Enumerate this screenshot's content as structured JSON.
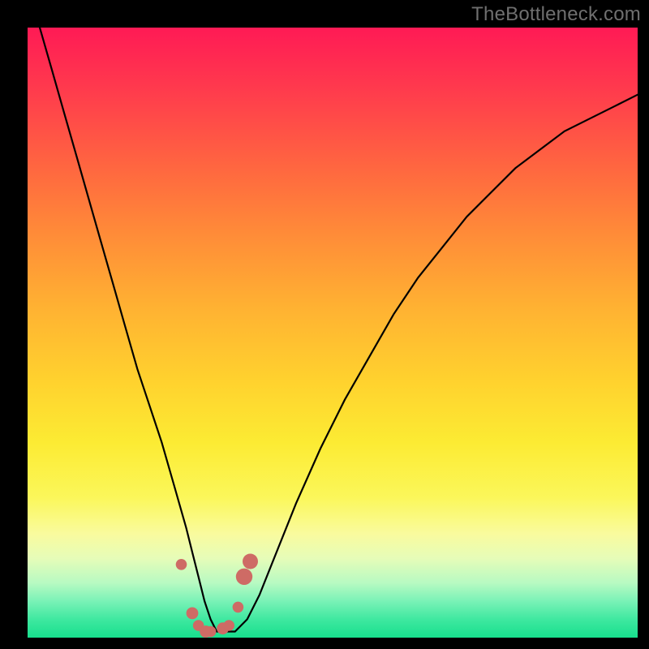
{
  "watermark": "TheBottleneck.com",
  "colors": {
    "frame": "#000000",
    "curve": "#000000",
    "markers": "#ce6b65",
    "gradient_top": "#ff1a55",
    "gradient_bottom": "#17df8d"
  },
  "chart_data": {
    "type": "line",
    "title": "",
    "xlabel": "",
    "ylabel": "",
    "xlim": [
      0,
      100
    ],
    "ylim": [
      0,
      100
    ],
    "series": [
      {
        "name": "bottleneck-curve",
        "x": [
          0,
          1,
          2,
          4,
          6,
          8,
          10,
          12,
          14,
          16,
          18,
          20,
          22,
          24,
          26,
          27,
          28,
          29,
          30,
          31,
          32,
          34,
          36,
          38,
          40,
          44,
          48,
          52,
          56,
          60,
          64,
          68,
          72,
          76,
          80,
          84,
          88,
          92,
          96,
          100
        ],
        "values": [
          108,
          104,
          100,
          93,
          86,
          79,
          72,
          65,
          58,
          51,
          44,
          38,
          32,
          25,
          18,
          14,
          10,
          6,
          3,
          1,
          1,
          1,
          3,
          7,
          12,
          22,
          31,
          39,
          46,
          53,
          59,
          64,
          69,
          73,
          77,
          80,
          83,
          85,
          87,
          89
        ]
      }
    ],
    "markers": [
      {
        "x": 25.2,
        "y": 12.0,
        "r": 1.0
      },
      {
        "x": 27.0,
        "y": 4.0,
        "r": 1.1
      },
      {
        "x": 28.0,
        "y": 2.0,
        "r": 1.0
      },
      {
        "x": 29.2,
        "y": 1.0,
        "r": 1.1
      },
      {
        "x": 30.0,
        "y": 1.0,
        "r": 1.0
      },
      {
        "x": 32.0,
        "y": 1.5,
        "r": 1.1
      },
      {
        "x": 33.0,
        "y": 2.0,
        "r": 1.0
      },
      {
        "x": 34.5,
        "y": 5.0,
        "r": 1.0
      },
      {
        "x": 35.5,
        "y": 10.0,
        "r": 1.5
      },
      {
        "x": 36.5,
        "y": 12.5,
        "r": 1.4
      }
    ]
  }
}
